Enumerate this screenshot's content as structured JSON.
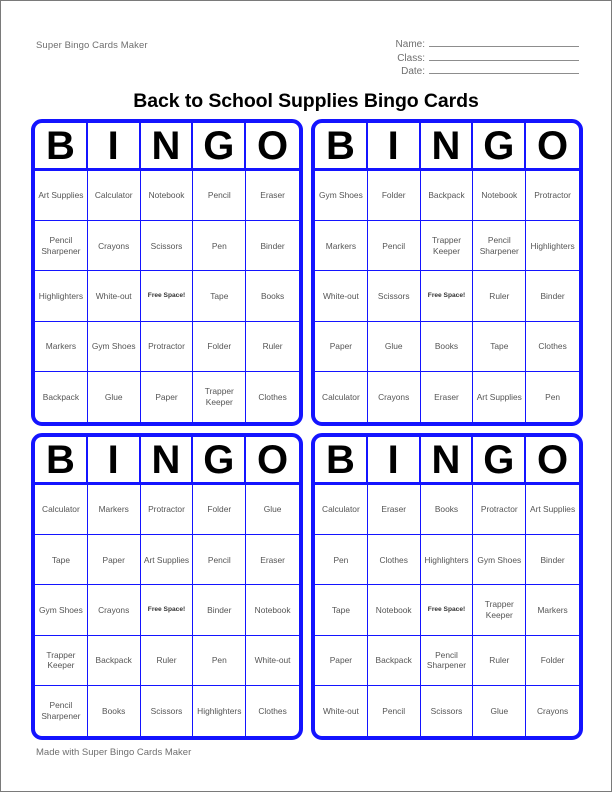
{
  "header": {
    "app_title": "Super Bingo Cards Maker",
    "fields": [
      {
        "label": "Name:",
        "value": ""
      },
      {
        "label": "Class:",
        "value": ""
      },
      {
        "label": "Date:",
        "value": ""
      }
    ]
  },
  "title": "Back to School Supplies Bingo Cards",
  "bingo_letters": [
    "B",
    "I",
    "N",
    "G",
    "O"
  ],
  "free_space_label": "Free Space!",
  "colors": {
    "card_border": "#1414ff",
    "grid_line": "#1414ff",
    "cell_text": "#555555",
    "letter_text": "#000000",
    "page_border": "#7a7a7a"
  },
  "cards": [
    {
      "id": "card-1",
      "cells": [
        "Art Supplies",
        "Calculator",
        "Notebook",
        "Pencil",
        "Eraser",
        "Pencil Sharpener",
        "Crayons",
        "Scissors",
        "Pen",
        "Binder",
        "Highlighters",
        "White-out",
        "Free Space!",
        "Tape",
        "Books",
        "Markers",
        "Gym Shoes",
        "Protractor",
        "Folder",
        "Ruler",
        "Backpack",
        "Glue",
        "Paper",
        "Trapper Keeper",
        "Clothes"
      ]
    },
    {
      "id": "card-2",
      "cells": [
        "Gym Shoes",
        "Folder",
        "Backpack",
        "Notebook",
        "Protractor",
        "Markers",
        "Pencil",
        "Trapper Keeper",
        "Pencil Sharpener",
        "Highlighters",
        "White-out",
        "Scissors",
        "Free Space!",
        "Ruler",
        "Binder",
        "Paper",
        "Glue",
        "Books",
        "Tape",
        "Clothes",
        "Calculator",
        "Crayons",
        "Eraser",
        "Art Supplies",
        "Pen"
      ]
    },
    {
      "id": "card-3",
      "cells": [
        "Calculator",
        "Markers",
        "Protractor",
        "Folder",
        "Glue",
        "Tape",
        "Paper",
        "Art Supplies",
        "Pencil",
        "Eraser",
        "Gym Shoes",
        "Crayons",
        "Free Space!",
        "Binder",
        "Notebook",
        "Trapper Keeper",
        "Backpack",
        "Ruler",
        "Pen",
        "White-out",
        "Pencil Sharpener",
        "Books",
        "Scissors",
        "Highlighters",
        "Clothes"
      ]
    },
    {
      "id": "card-4",
      "cells": [
        "Calculator",
        "Eraser",
        "Books",
        "Protractor",
        "Art Supplies",
        "Pen",
        "Clothes",
        "Highlighters",
        "Gym Shoes",
        "Binder",
        "Tape",
        "Notebook",
        "Free Space!",
        "Trapper Keeper",
        "Markers",
        "Paper",
        "Backpack",
        "Pencil Sharpener",
        "Ruler",
        "Folder",
        "White-out",
        "Pencil",
        "Scissors",
        "Glue",
        "Crayons"
      ]
    }
  ],
  "footer": "Made with Super Bingo Cards Maker"
}
